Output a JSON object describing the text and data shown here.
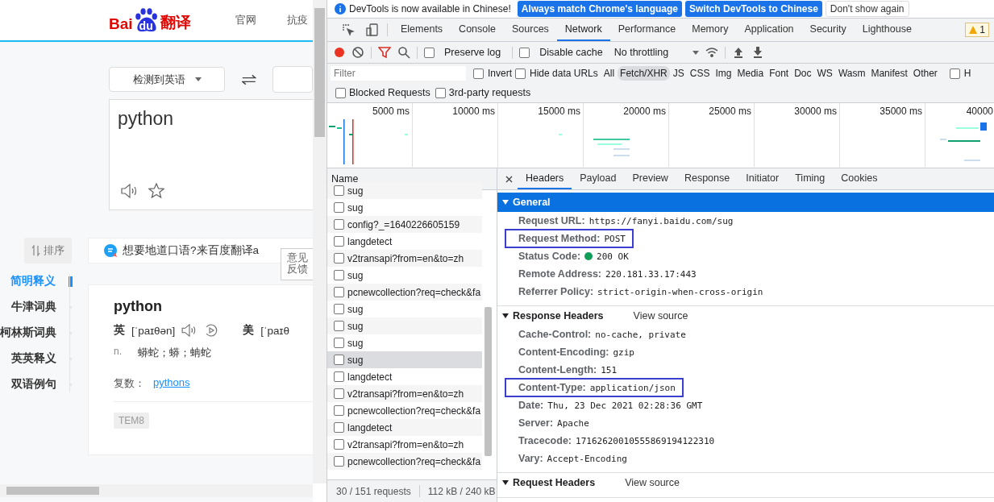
{
  "baidu_page": {
    "logo": {
      "part_1": "Bai",
      "part_2": "du",
      "part_3": "翻译"
    },
    "nav": [
      "官网",
      "抗疫"
    ],
    "source_language": "检测到英语",
    "input_text": "python",
    "sort_button": "排序",
    "banner": "想要地道口语?来百度翻译a",
    "feedback": "意见反馈",
    "dict_nav": [
      {
        "label": "简明释义",
        "selected": true
      },
      {
        "label": "牛津词典",
        "selected": false
      },
      {
        "label": "柯林斯词典",
        "selected": false
      },
      {
        "label": "英英释义",
        "selected": false
      },
      {
        "label": "双语例句",
        "selected": false
      }
    ],
    "entry": {
      "word": "python",
      "phonetics": [
        {
          "region": "英",
          "ipa": "[ˈpaɪθən]",
          "kind": "full"
        },
        {
          "region": "美",
          "ipa": "[ˈpaɪθ",
          "kind": "cut"
        }
      ],
      "pos": "n.",
      "meanings": "蟒蛇；蟒；蚺蛇",
      "plural_label": "复数：",
      "plural": "pythons",
      "tag": "TEM8"
    }
  },
  "devtools": {
    "infobar": {
      "message": "DevTools is now available in Chinese!",
      "buttons": [
        "Always match Chrome's language",
        "Switch DevTools to Chinese"
      ],
      "dismiss": "Don't show again"
    },
    "panel_tabs": [
      {
        "label": "Elements",
        "selected": false
      },
      {
        "label": "Console",
        "selected": false
      },
      {
        "label": "Sources",
        "selected": false
      },
      {
        "label": "Network",
        "selected": true
      },
      {
        "label": "Performance",
        "selected": false
      },
      {
        "label": "Memory",
        "selected": false
      },
      {
        "label": "Application",
        "selected": false
      },
      {
        "label": "Security",
        "selected": false
      },
      {
        "label": "Lighthouse",
        "selected": false
      }
    ],
    "warning_count": "1",
    "toolbar": {
      "recording": true,
      "preserve_log": {
        "label": "Preserve log",
        "checked": false
      },
      "disable_cache": {
        "label": "Disable cache",
        "checked": false
      },
      "throttling": "No throttling"
    },
    "filter": {
      "placeholder": "Filter",
      "invert": {
        "label": "Invert",
        "checked": false
      },
      "hide_data_urls": {
        "label": "Hide data URLs",
        "checked": false
      },
      "types": [
        {
          "label": "All",
          "selected": false
        },
        {
          "label": "Fetch/XHR",
          "selected": true
        },
        {
          "label": "JS",
          "selected": false
        },
        {
          "label": "CSS",
          "selected": false
        },
        {
          "label": "Img",
          "selected": false
        },
        {
          "label": "Media",
          "selected": false
        },
        {
          "label": "Font",
          "selected": false
        },
        {
          "label": "Doc",
          "selected": false
        },
        {
          "label": "WS",
          "selected": false
        },
        {
          "label": "Wasm",
          "selected": false
        },
        {
          "label": "Manifest",
          "selected": false
        },
        {
          "label": "Other",
          "selected": false
        }
      ],
      "extra": {
        "label": "H",
        "checked": false
      },
      "blocked_requests": {
        "label": "Blocked Requests",
        "checked": false
      },
      "third_party": {
        "label": "3rd-party requests",
        "checked": false
      }
    },
    "overview": {
      "ticks": [
        "5000 ms",
        "10000 ms",
        "15000 ms",
        "20000 ms",
        "25000 ms",
        "30000 ms",
        "35000 ms",
        "40000"
      ]
    },
    "requests": {
      "header": "Name",
      "rows": [
        {
          "name": "sug",
          "selected": false
        },
        {
          "name": "sug",
          "selected": false
        },
        {
          "name": "config?_=1640226605159",
          "selected": false
        },
        {
          "name": "langdetect",
          "selected": false
        },
        {
          "name": "v2transapi?from=en&to=zh",
          "selected": false
        },
        {
          "name": "sug",
          "selected": false
        },
        {
          "name": "pcnewcollection?req=check&fa",
          "selected": false
        },
        {
          "name": "sug",
          "selected": false
        },
        {
          "name": "sug",
          "selected": false
        },
        {
          "name": "sug",
          "selected": false
        },
        {
          "name": "sug",
          "selected": true
        },
        {
          "name": "langdetect",
          "selected": false
        },
        {
          "name": "v2transapi?from=en&to=zh",
          "selected": false
        },
        {
          "name": "pcnewcollection?req=check&fa",
          "selected": false
        },
        {
          "name": "langdetect",
          "selected": false
        },
        {
          "name": "v2transapi?from=en&to=zh",
          "selected": false
        },
        {
          "name": "pcnewcollection?req=check&fa",
          "selected": false
        }
      ]
    },
    "summary": {
      "requests": "30 / 151 requests",
      "transferred": "112 kB / 240 kB"
    },
    "detail_tabs": [
      {
        "label": "Headers",
        "selected": true
      },
      {
        "label": "Payload",
        "selected": false
      },
      {
        "label": "Preview",
        "selected": false
      },
      {
        "label": "Response",
        "selected": false
      },
      {
        "label": "Initiator",
        "selected": false
      },
      {
        "label": "Timing",
        "selected": false
      },
      {
        "label": "Cookies",
        "selected": false
      }
    ],
    "sections": [
      {
        "title": "General",
        "selected": true,
        "rows": [
          {
            "name": "Request URL:",
            "value": "https://fanyi.baidu.com/sug",
            "highlighted": false,
            "kind": "plain"
          },
          {
            "name": "Request Method:",
            "value": "POST",
            "highlighted": true,
            "kind": "plain"
          },
          {
            "name": "Status Code:",
            "value": "200 OK",
            "highlighted": false,
            "kind": "status"
          },
          {
            "name": "Remote Address:",
            "value": "220.181.33.17:443",
            "highlighted": false,
            "kind": "plain"
          },
          {
            "name": "Referrer Policy:",
            "value": "strict-origin-when-cross-origin",
            "highlighted": false,
            "kind": "plain"
          }
        ]
      },
      {
        "title": "Response Headers",
        "selected": false,
        "view_source": "View source",
        "rows": [
          {
            "name": "Cache-Control:",
            "value": "no-cache, private",
            "highlighted": false,
            "kind": "plain"
          },
          {
            "name": "Content-Encoding:",
            "value": "gzip",
            "highlighted": false,
            "kind": "plain"
          },
          {
            "name": "Content-Length:",
            "value": "151",
            "highlighted": false,
            "kind": "plain"
          },
          {
            "name": "Content-Type:",
            "value": "application/json",
            "highlighted": true,
            "kind": "plain"
          },
          {
            "name": "Date:",
            "value": "Thu, 23 Dec 2021 02:28:36 GMT",
            "highlighted": false,
            "kind": "plain"
          },
          {
            "name": "Server:",
            "value": "Apache",
            "highlighted": false,
            "kind": "plain"
          },
          {
            "name": "Tracecode:",
            "value": "17162620010555869194122310",
            "highlighted": false,
            "kind": "plain"
          },
          {
            "name": "Vary:",
            "value": "Accept-Encoding",
            "highlighted": false,
            "kind": "plain"
          }
        ]
      },
      {
        "title": "Request Headers",
        "selected": false,
        "view_source": "View source"
      }
    ]
  }
}
